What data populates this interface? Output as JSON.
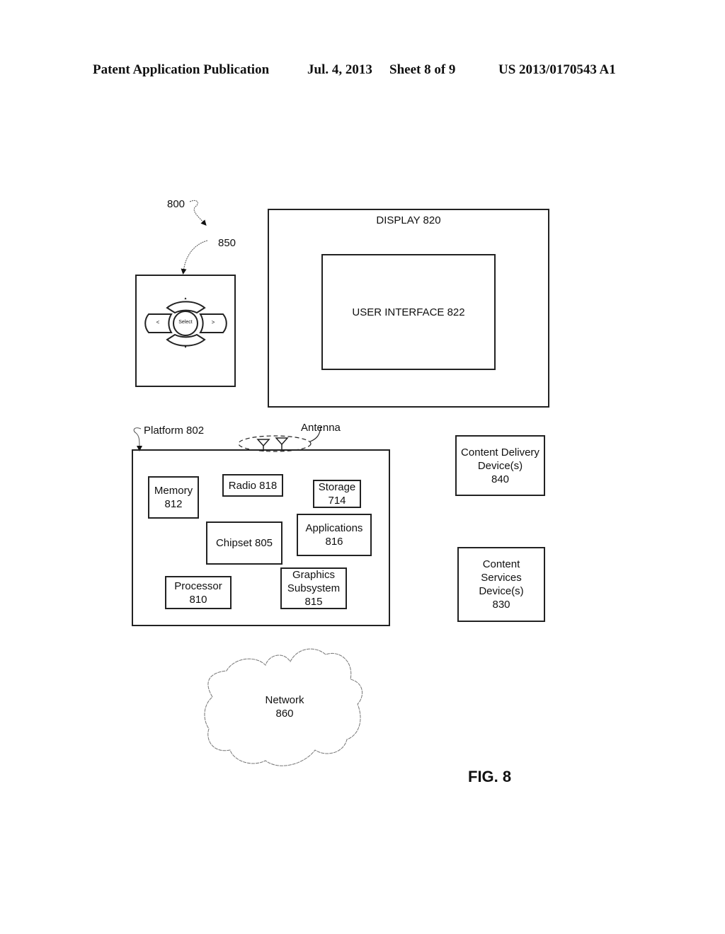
{
  "header": {
    "publication": "Patent Application Publication",
    "date": "Jul. 4, 2013",
    "sheet": "Sheet 8 of 9",
    "number": "US 2013/0170543 A1"
  },
  "labels": {
    "system_ref": "800",
    "remote_ref": "850",
    "platform": "Platform 802",
    "antenna": "Antenna",
    "figure": "FIG. 8"
  },
  "remote": {
    "select": "Select",
    "left": "<",
    "right": ">",
    "up": "▲",
    "down": "▼"
  },
  "display": {
    "title": "DISPLAY 820",
    "ui": "USER INTERFACE 822"
  },
  "platform_components": {
    "memory": [
      "Memory",
      "812"
    ],
    "radio": [
      "Radio 818"
    ],
    "storage": [
      "Storage",
      "714"
    ],
    "chipset": [
      "Chipset 805"
    ],
    "applications": [
      "Applications",
      "816"
    ],
    "processor": [
      "Processor",
      "810"
    ],
    "graphics": [
      "Graphics",
      "Subsystem",
      "815"
    ]
  },
  "external": {
    "content_delivery": [
      "Content Delivery",
      "Device(s)",
      "840"
    ],
    "content_services": [
      "Content",
      "Services",
      "Device(s)",
      "830"
    ]
  },
  "network": [
    "Network",
    "860"
  ]
}
